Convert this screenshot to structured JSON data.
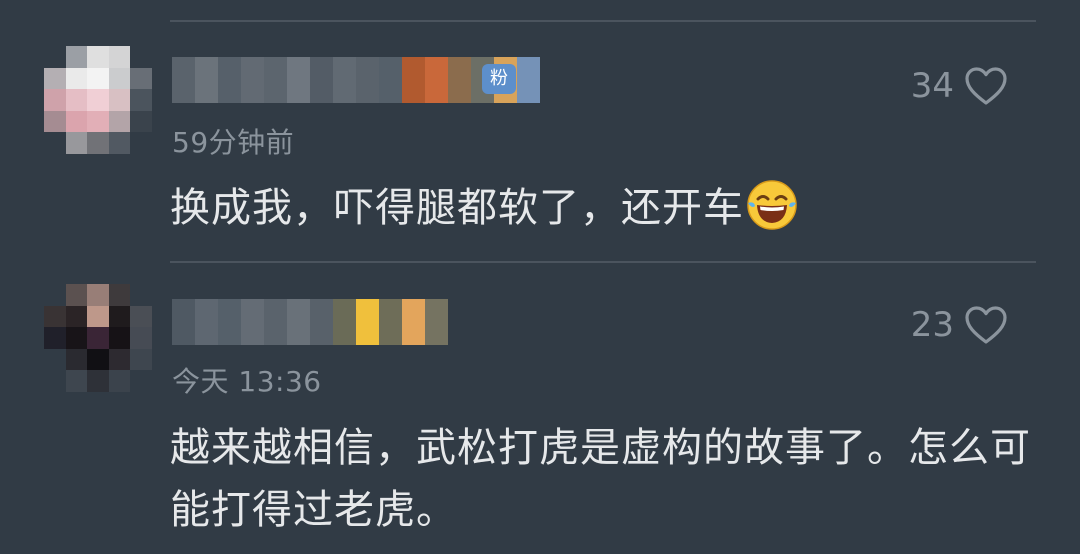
{
  "comments": [
    {
      "badge": "粉",
      "time": "59分钟前",
      "text": "换成我，吓得腿都软了，还开车",
      "emoji": "laughing-tears-emoji",
      "likes": "34"
    },
    {
      "time": "今天 13:36",
      "text": "越来越相信，武松打虎是虚构的故事了。怎么可能打得过老虎。",
      "likes": "23"
    }
  ],
  "colors": {
    "background": "#313b45",
    "divider": "#4b545e",
    "secondary_text": "#8b949d",
    "primary_text": "#e6e8ea",
    "badge": "#5d8fcb"
  },
  "icons": {
    "like": "heart-outline-icon"
  }
}
